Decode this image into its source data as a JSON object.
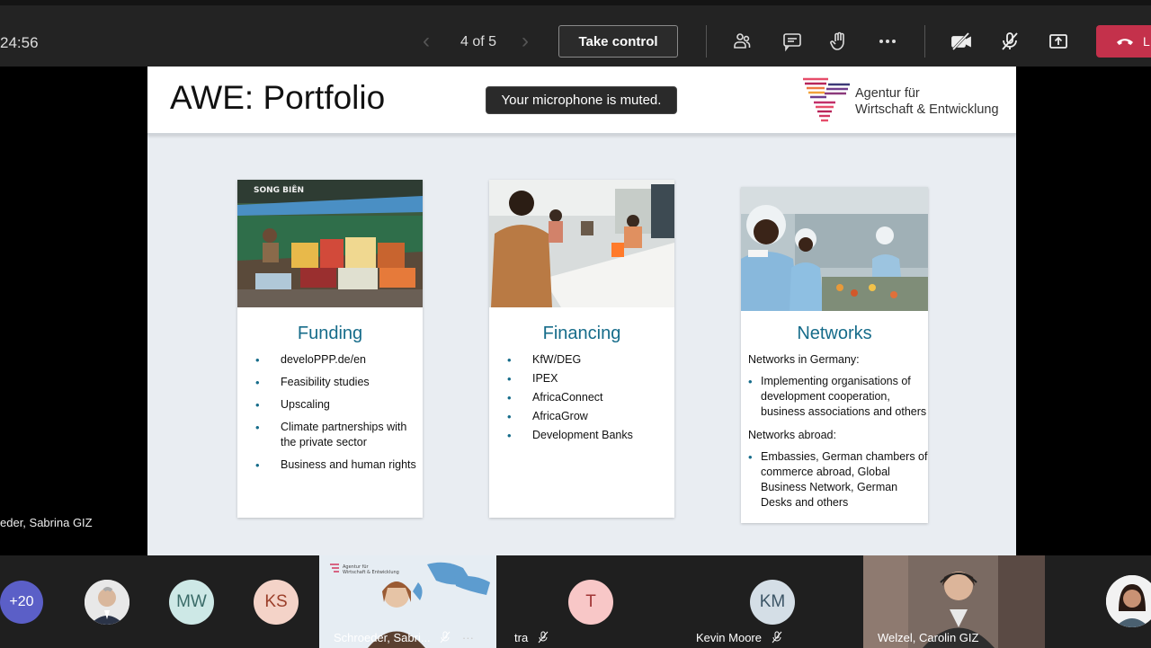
{
  "toolbar": {
    "timer": "24:56",
    "prev_icon": "chevron-left-icon",
    "next_icon": "chevron-right-icon",
    "page_indicator": "4 of 5",
    "take_control_label": "Take control",
    "icons": [
      "people-icon",
      "chat-icon",
      "raise-hand-icon",
      "more-icon",
      "camera-off-icon",
      "mic-off-icon",
      "share-icon"
    ],
    "leave_label": "L",
    "leave_color": "#c4314b"
  },
  "toast": {
    "text": "Your microphone is muted."
  },
  "presenter": {
    "name": "eder, Sabrina GIZ"
  },
  "slide": {
    "title": "AWE: Portfolio",
    "logo_text_line1": "Agentur für",
    "logo_text_line2": "Wirtschaft & Entwicklung",
    "accent_color": "#166c8a",
    "cards": [
      {
        "title": "Funding",
        "image_caption": "SONG BIÊN",
        "items": [
          "develoPPP.de/en",
          "Feasibility studies",
          "Upscaling",
          "Climate partnerships with the private sector",
          "Business and human rights"
        ]
      },
      {
        "title": "Financing",
        "items": [
          "KfW/DEG",
          "IPEX",
          "AfricaConnect",
          "AfricaGrow",
          "Development Banks"
        ]
      },
      {
        "title": "Networks",
        "germany_heading": "Networks in Germany:",
        "germany_items": [
          "Implementing organisations of development cooperation, business associations and others"
        ],
        "abroad_heading": "Networks abroad:",
        "abroad_items": [
          "Embassies, German chambers of commerce abroad, Global Business Network, German Desks and others"
        ]
      }
    ]
  },
  "participants": {
    "overflow": "+20",
    "mw": "MW",
    "ks": "KS",
    "schroeder": "Schroeder, Sabri...",
    "tra_initial": "T",
    "tra_name": "tra",
    "kevin_initials": "KM",
    "kevin_name": "Kevin Moore",
    "welzel": "Welzel, Carolin GIZ",
    "tile_logo_l1": "Agentur für",
    "tile_logo_l2": "Wirtschaft & Entwicklung"
  }
}
